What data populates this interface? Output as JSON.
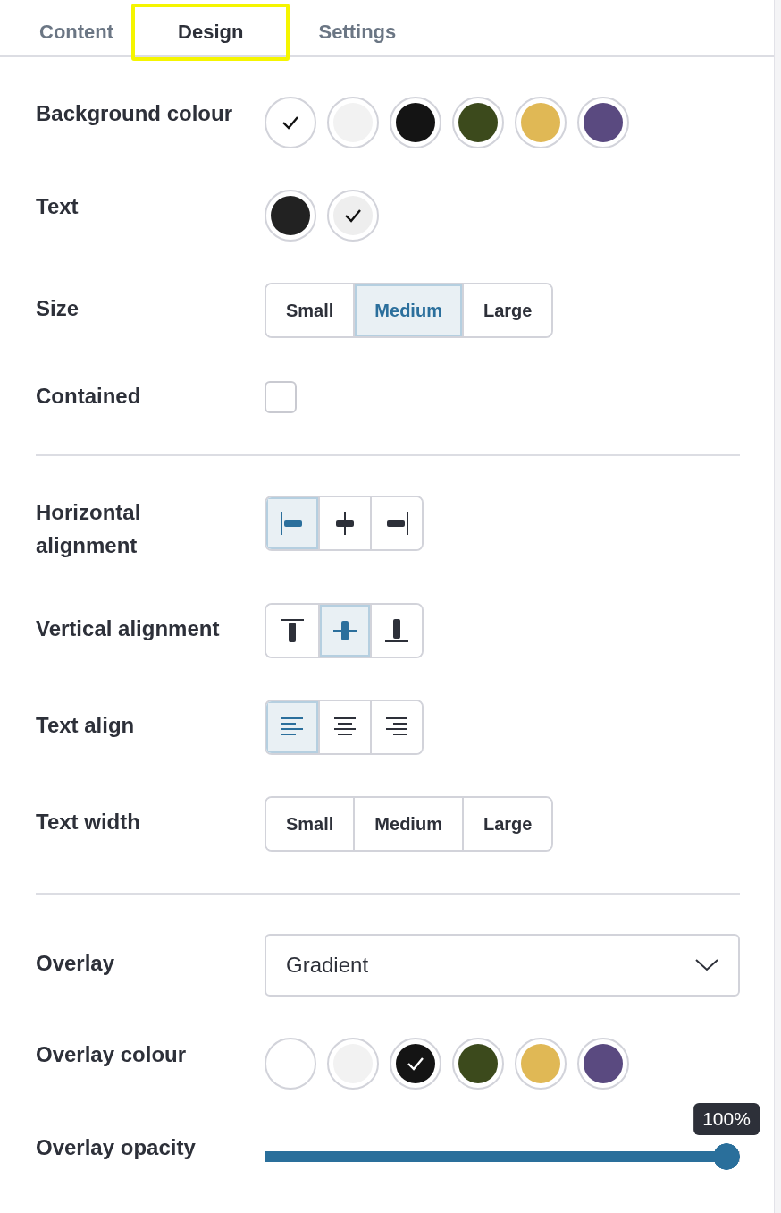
{
  "tabs": [
    {
      "label": "Content",
      "selected": false
    },
    {
      "label": "Design",
      "selected": true
    },
    {
      "label": "Settings",
      "selected": false
    }
  ],
  "sections": [
    {
      "rows": [
        {
          "kind": "swatches",
          "label": "Background colour",
          "options": [
            {
              "color": "#ffffff",
              "selected": true
            },
            {
              "color": "#f2f2f2",
              "selected": false
            },
            {
              "color": "#141414",
              "selected": false
            },
            {
              "color": "#3c4a1c",
              "selected": false
            },
            {
              "color": "#e0b855",
              "selected": false
            },
            {
              "color": "#5a4a80",
              "selected": false
            }
          ]
        },
        {
          "kind": "swatches",
          "label": "Text",
          "options": [
            {
              "color": "#222222",
              "selected": false
            },
            {
              "color": "#eeeeee",
              "selected": true
            }
          ]
        },
        {
          "kind": "segmented",
          "label": "Size",
          "options": [
            {
              "label": "Small",
              "selected": false
            },
            {
              "label": "Medium",
              "selected": true
            },
            {
              "label": "Large",
              "selected": false
            }
          ]
        },
        {
          "kind": "checkbox",
          "label": "Contained",
          "checked": false
        }
      ]
    },
    {
      "rows": [
        {
          "kind": "h-align",
          "label": "Horizontal alignment",
          "options": [
            {
              "selected": true
            },
            {
              "selected": false
            },
            {
              "selected": false
            }
          ]
        },
        {
          "kind": "v-align",
          "label": "Vertical alignment",
          "options": [
            {
              "selected": false
            },
            {
              "selected": true
            },
            {
              "selected": false
            }
          ]
        },
        {
          "kind": "text-align",
          "label": "Text align",
          "options": [
            {
              "selected": true
            },
            {
              "selected": false
            },
            {
              "selected": false
            }
          ]
        },
        {
          "kind": "segmented",
          "label": "Text width",
          "options": [
            {
              "label": "Small",
              "selected": false
            },
            {
              "label": "Medium",
              "selected": false
            },
            {
              "label": "Large",
              "selected": false
            }
          ]
        }
      ]
    },
    {
      "rows": [
        {
          "kind": "select",
          "label": "Overlay",
          "value": "Gradient"
        },
        {
          "kind": "swatches",
          "label": "Overlay colour",
          "options": [
            {
              "color": "#ffffff",
              "selected": false
            },
            {
              "color": "#f2f2f2",
              "selected": false
            },
            {
              "color": "#141414",
              "selected": true
            },
            {
              "color": "#3c4a1c",
              "selected": false
            },
            {
              "color": "#e0b855",
              "selected": false
            },
            {
              "color": "#5a4a80",
              "selected": false
            }
          ]
        },
        {
          "kind": "slider",
          "label": "Overlay opacity",
          "level": 1,
          "reading": "100%"
        }
      ]
    }
  ]
}
